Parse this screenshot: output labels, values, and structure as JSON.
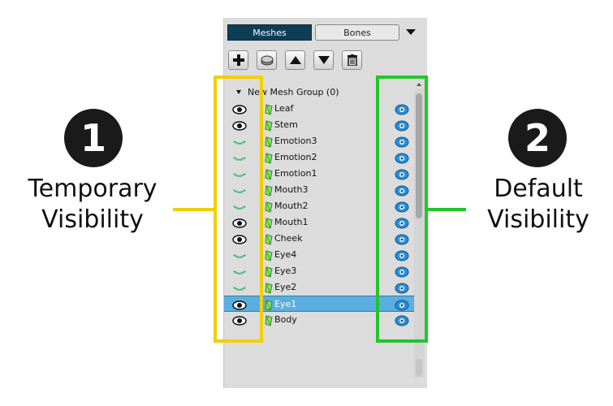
{
  "panel": {
    "tabs": [
      {
        "label": "Meshes",
        "active": true
      },
      {
        "label": "Bones",
        "active": false
      }
    ],
    "toolbar": [
      "add-icon",
      "mesh-icon",
      "move-up-icon",
      "move-down-icon",
      "trash-icon"
    ],
    "group": {
      "label": "New Mesh Group (0)"
    },
    "items": [
      {
        "label": "Leaf",
        "temp": "eye"
      },
      {
        "label": "Stem",
        "temp": "eye"
      },
      {
        "label": "Emotion3",
        "temp": "closed"
      },
      {
        "label": "Emotion2",
        "temp": "closed"
      },
      {
        "label": "Emotion1",
        "temp": "closed"
      },
      {
        "label": "Mouth3",
        "temp": "closed"
      },
      {
        "label": "Mouth2",
        "temp": "closed"
      },
      {
        "label": "Mouth1",
        "temp": "eye"
      },
      {
        "label": "Cheek",
        "temp": "eye"
      },
      {
        "label": "Eye4",
        "temp": "closed"
      },
      {
        "label": "Eye3",
        "temp": "closed"
      },
      {
        "label": "Eye2",
        "temp": "closed"
      },
      {
        "label": "Eye1",
        "temp": "eye",
        "selected": true
      },
      {
        "label": "Body",
        "temp": "eye"
      }
    ]
  },
  "annotations": {
    "left": {
      "number": "1",
      "line1": "Temporary",
      "line2": "Visibility",
      "color": "#f2cf00"
    },
    "right": {
      "number": "2",
      "line1": "Default",
      "line2": "Visibility",
      "color": "#22c52a"
    }
  },
  "colors": {
    "tab_active": "#0f3d55",
    "selected_row": "#5aaee0",
    "default_eye": "#2a8fd6",
    "mesh_icon": "#44b833"
  }
}
